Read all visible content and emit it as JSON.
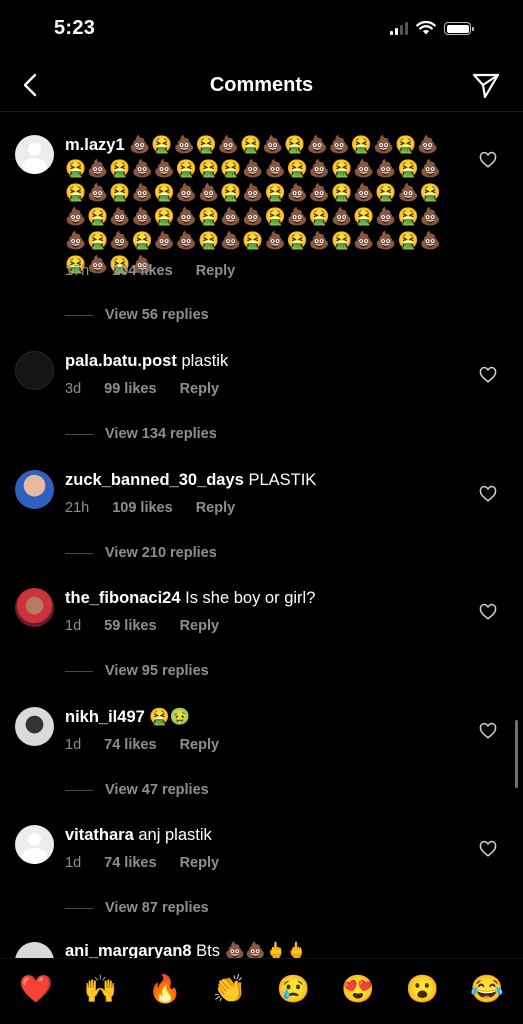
{
  "status_bar": {
    "time": "5:23"
  },
  "nav": {
    "title": "Comments",
    "back_icon": "chevron-left-icon",
    "share_icon": "paper-plane-icon"
  },
  "comments": [
    {
      "username": "m.lazy1",
      "text": "💩🤮💩🤮💩🤮💩🤮💩💩🤮💩🤮💩🤮💩🤮💩💩🤮🤮🤮💩💩🤮💩🤮💩💩🤮💩🤮💩🤮💩🤮💩💩🤮💩🤮💩💩🤮💩🤮💩🤮💩🤮💩💩🤮💩🤮💩💩🤮💩🤮💩🤮💩🤮💩💩🤮💩🤮💩💩🤮💩🤮💩🤮💩🤮💩💩🤮💩🤮💩🤮💩",
      "time": "17h",
      "likes": "104 likes",
      "reply": "Reply",
      "replies": "View 56 replies",
      "avatar": "default"
    },
    {
      "username": "pala.batu.post",
      "text": "plastik",
      "time": "3d",
      "likes": "99 likes",
      "reply": "Reply",
      "replies": "View 134 replies",
      "avatar": "dark"
    },
    {
      "username": "zuck_banned_30_days",
      "text": "PLASTIK",
      "time": "21h",
      "likes": "109 likes",
      "reply": "Reply",
      "replies": "View 210 replies",
      "avatar": "blue"
    },
    {
      "username": "the_fibonaci24",
      "text": "Is she boy or  girl?",
      "time": "1d",
      "likes": "59 likes",
      "reply": "Reply",
      "replies": "View 95 replies",
      "avatar": "red"
    },
    {
      "username": "nikh_il497",
      "text": "🤮🤢",
      "time": "1d",
      "likes": "74 likes",
      "reply": "Reply",
      "replies": "View 47 replies",
      "avatar": "grey"
    },
    {
      "username": "vitathara",
      "text": "anj plastik",
      "time": "1d",
      "likes": "74 likes",
      "reply": "Reply",
      "replies": "View 87 replies",
      "avatar": "default"
    }
  ],
  "partial_comment": {
    "username": "ani_margaryan8",
    "text": "Bts 💩💩🖕🖕"
  },
  "emoji_bar": [
    "❤️",
    "🙌",
    "🔥",
    "👏",
    "😢",
    "😍",
    "😮",
    "😂"
  ],
  "colors": {
    "background": "#000000",
    "meta_text": "#8e8e8e",
    "heart_outline": "#d0d0d0"
  }
}
